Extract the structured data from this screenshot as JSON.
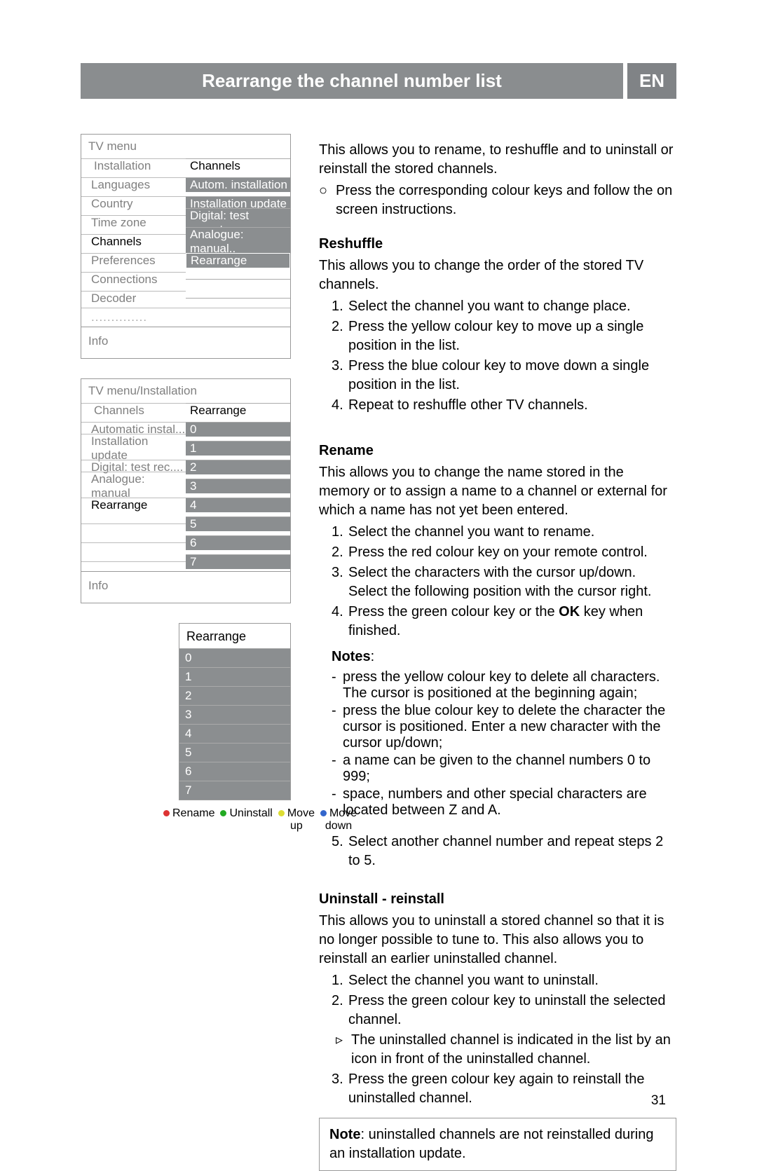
{
  "header": {
    "title": "Rearrange the channel number list",
    "lang": "EN"
  },
  "menu1": {
    "title": "TV menu",
    "left": [
      "Installation",
      "Languages",
      "Country",
      "Time zone",
      "Channels",
      "Preferences",
      "Connections",
      "Decoder"
    ],
    "rightHeader": "Channels",
    "right": [
      "Autom. installation",
      "Installation update",
      "Digital: test recept..",
      "Analogue: manual..",
      "Rearrange"
    ],
    "dots": "..............",
    "info": "Info"
  },
  "menu2": {
    "title": "TV menu/Installation",
    "left": [
      "Channels",
      "Automatic instal...",
      "Installation update",
      "Digital: test rec....",
      "Analogue: manual",
      "Rearrange"
    ],
    "rightHeader": "Rearrange",
    "right": [
      "0",
      "1",
      "2",
      "3",
      "4",
      "5",
      "6",
      "7"
    ],
    "info": "Info"
  },
  "menu3": {
    "title": "Rearrange",
    "cells": [
      "0",
      "1",
      "2",
      "3",
      "4",
      "5",
      "6",
      "7"
    ],
    "keys": {
      "rename": "Rename",
      "uninstall": "Uninstall",
      "moveup1": "Move",
      "moveup2": "up",
      "movedown1": "Move",
      "movedown2": "down"
    }
  },
  "intro": {
    "p1": "This allows you to rename, to reshuffle and to uninstall or reinstall the stored channels.",
    "p2": "Press the corresponding colour keys and follow the on screen instructions."
  },
  "reshuffle": {
    "title": "Reshuffle",
    "desc": "This allows you to change the order of the stored TV channels.",
    "s1": "Select the channel you want to change place.",
    "s2": "Press the yellow colour key  to move up a single position in the list.",
    "s3": "Press the blue colour key to move down a single position in the list.",
    "s4": "Repeat to reshuffle other TV channels."
  },
  "rename": {
    "title": "Rename",
    "desc": "This allows you to change the name stored in the memory or to assign a name to a channel or external for which a name has not yet been entered.",
    "s1": "Select the channel you want to rename.",
    "s2": "Press the red colour key on your remote control.",
    "s3": "Select the characters with the cursor up/down. Select the following position with the cursor right.",
    "s4a": "Press the green colour key or the ",
    "s4b": "OK",
    "s4c": " key when finished.",
    "notesLabel": "Notes",
    "n1": "press the yellow colour key to delete all characters. The cursor is positioned at the beginning again;",
    "n2": "press the blue colour key to delete the character the cursor is positioned. Enter a new character with the cursor up/down;",
    "n3": "a name can be given to the channel numbers 0 to 999;",
    "n4": "space, numbers and other special characters are located between Z and A.",
    "s5": "Select another channel number and repeat steps 2 to 5."
  },
  "uninstall": {
    "title": "Uninstall - reinstall",
    "desc": "This allows you to uninstall a stored channel so that it is no longer possible to tune to. This also allows you to reinstall an earlier uninstalled channel.",
    "s1": "Select the channel you want to uninstall.",
    "s2": "Press the green colour key to uninstall the selected channel.",
    "s2sub": "The uninstalled channel is indicated in the list by an icon in front of the uninstalled channel.",
    "s3": "Press the green colour key again to reinstall the uninstalled channel.",
    "noteLabel": "Note",
    "noteText": ": uninstalled channels are not reinstalled during an installation update."
  },
  "pageNumber": "31"
}
